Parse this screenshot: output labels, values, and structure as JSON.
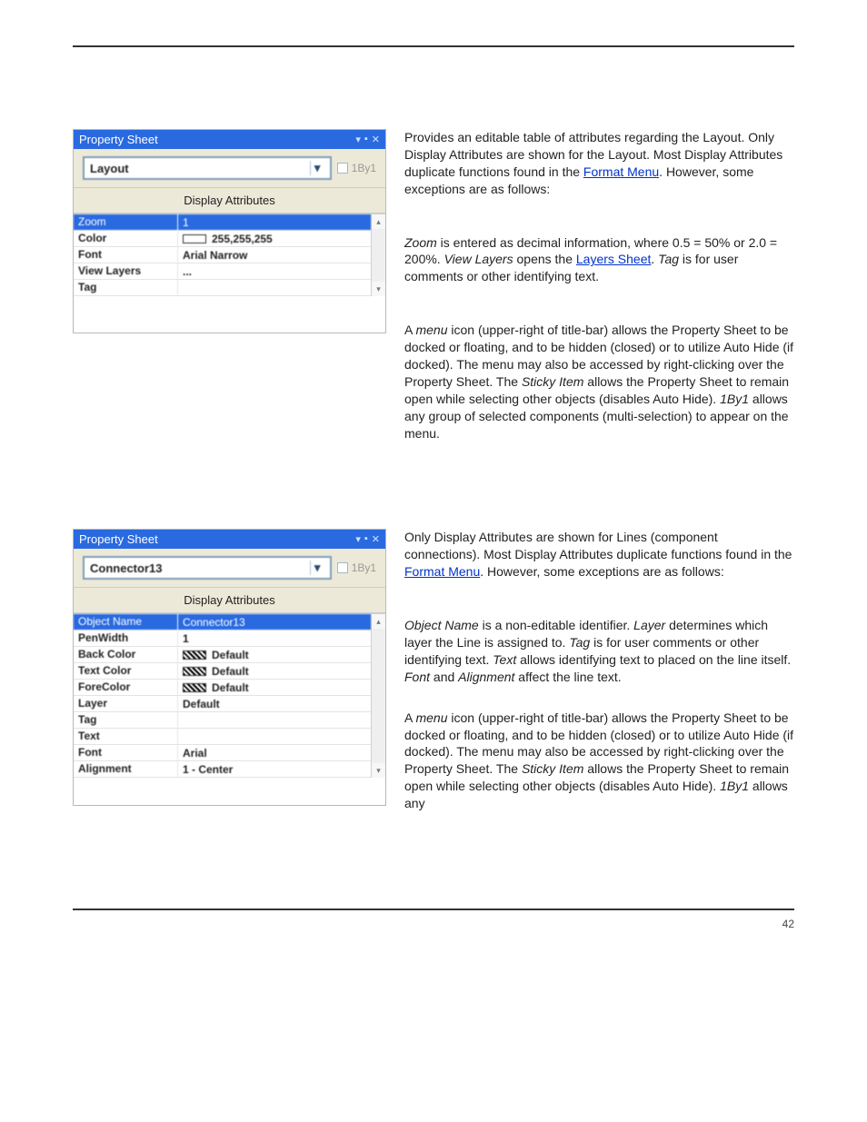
{
  "panel1": {
    "title": "Property Sheet",
    "combo": "Layout",
    "byone": "1By1",
    "section": "Display Attributes",
    "rows": [
      {
        "k": "Zoom",
        "v": "1",
        "header": true
      },
      {
        "k": "Color",
        "v": "255,255,255",
        "swatch": "white"
      },
      {
        "k": "Font",
        "v": "Arial Narrow"
      },
      {
        "k": "View Layers",
        "v": "..."
      },
      {
        "k": "Tag",
        "v": ""
      }
    ]
  },
  "text1a": "Provides an editable table of attributes regarding the Layout. Only Display Attributes are shown for the Layout. Most Display Attributes duplicate functions found in the ",
  "text1a_link": "Format Menu",
  "text1a_tail": ". However, some exceptions are as follows:",
  "text1b_1": "Zoom",
  "text1b_2": " is entered as decimal information, where 0.5 = 50% or 2.0 = 200%. ",
  "text1b_3": "View Layers",
  "text1b_4": " opens the ",
  "text1b_link": "Layers Sheet",
  "text1b_5": ". ",
  "text1b_6": "Tag",
  "text1b_7": " is for user comments or other identifying text.",
  "text1c_1": "A ",
  "text1c_2": "menu",
  "text1c_3": " icon (upper-right of title-bar) allows the Property Sheet to be docked or floating, and to be hidden (closed) or to utilize Auto Hide (if docked). The menu may also be accessed by right-clicking over the Property Sheet. The ",
  "text1c_4": "Sticky Item",
  "text1c_5": " allows the Property Sheet to remain open while selecting other objects (disables Auto Hide). ",
  "text1c_6": "1By1",
  "text1c_7": " allows any group of selected components (multi-selection) to appear on the menu.",
  "panel2": {
    "title": "Property Sheet",
    "combo": "Connector13",
    "byone": "1By1",
    "section": "Display Attributes",
    "rows": [
      {
        "k": "Object Name",
        "v": "Connector13",
        "header": true
      },
      {
        "k": "PenWidth",
        "v": "1"
      },
      {
        "k": "Back Color",
        "v": "Default",
        "swatch": "hatch"
      },
      {
        "k": "Text Color",
        "v": "Default",
        "swatch": "hatch"
      },
      {
        "k": "ForeColor",
        "v": "Default",
        "swatch": "hatch"
      },
      {
        "k": "Layer",
        "v": "Default"
      },
      {
        "k": "Tag",
        "v": ""
      },
      {
        "k": "Text",
        "v": ""
      },
      {
        "k": "Font",
        "v": "Arial"
      },
      {
        "k": "Alignment",
        "v": "1 - Center"
      }
    ]
  },
  "text2a": "Only Display Attributes are shown for Lines (component connections). Most Display Attributes duplicate functions found in the ",
  "text2a_link": "Format Menu",
  "text2a_tail": ". However, some exceptions are as follows:",
  "text2b_1": "Object Name",
  "text2b_2": " is a non-editable identifier. ",
  "text2b_3": "Layer",
  "text2b_4": " determines which layer the Line is assigned to. ",
  "text2b_5": "Tag",
  "text2b_6": " is for user comments or other identifying text. ",
  "text2b_7": "Text",
  "text2b_8": " allows identifying text to placed on the line itself. ",
  "text2b_9": "Font",
  "text2b_10": " and ",
  "text2b_11": "Alignment",
  "text2b_12": " affect the line text.",
  "text2c_1": "A ",
  "text2c_2": "menu",
  "text2c_3": " icon (upper-right of title-bar) allows the Property Sheet to be docked or floating, and to be hidden (closed) or to utilize Auto Hide (if docked). The menu may also be accessed by right-clicking over the Property Sheet. The ",
  "text2c_4": "Sticky Item",
  "text2c_5": " allows the Property Sheet to remain open while selecting other objects (disables Auto Hide). ",
  "text2c_6": "1By1",
  "text2c_7": " allows any",
  "page_num": "42"
}
